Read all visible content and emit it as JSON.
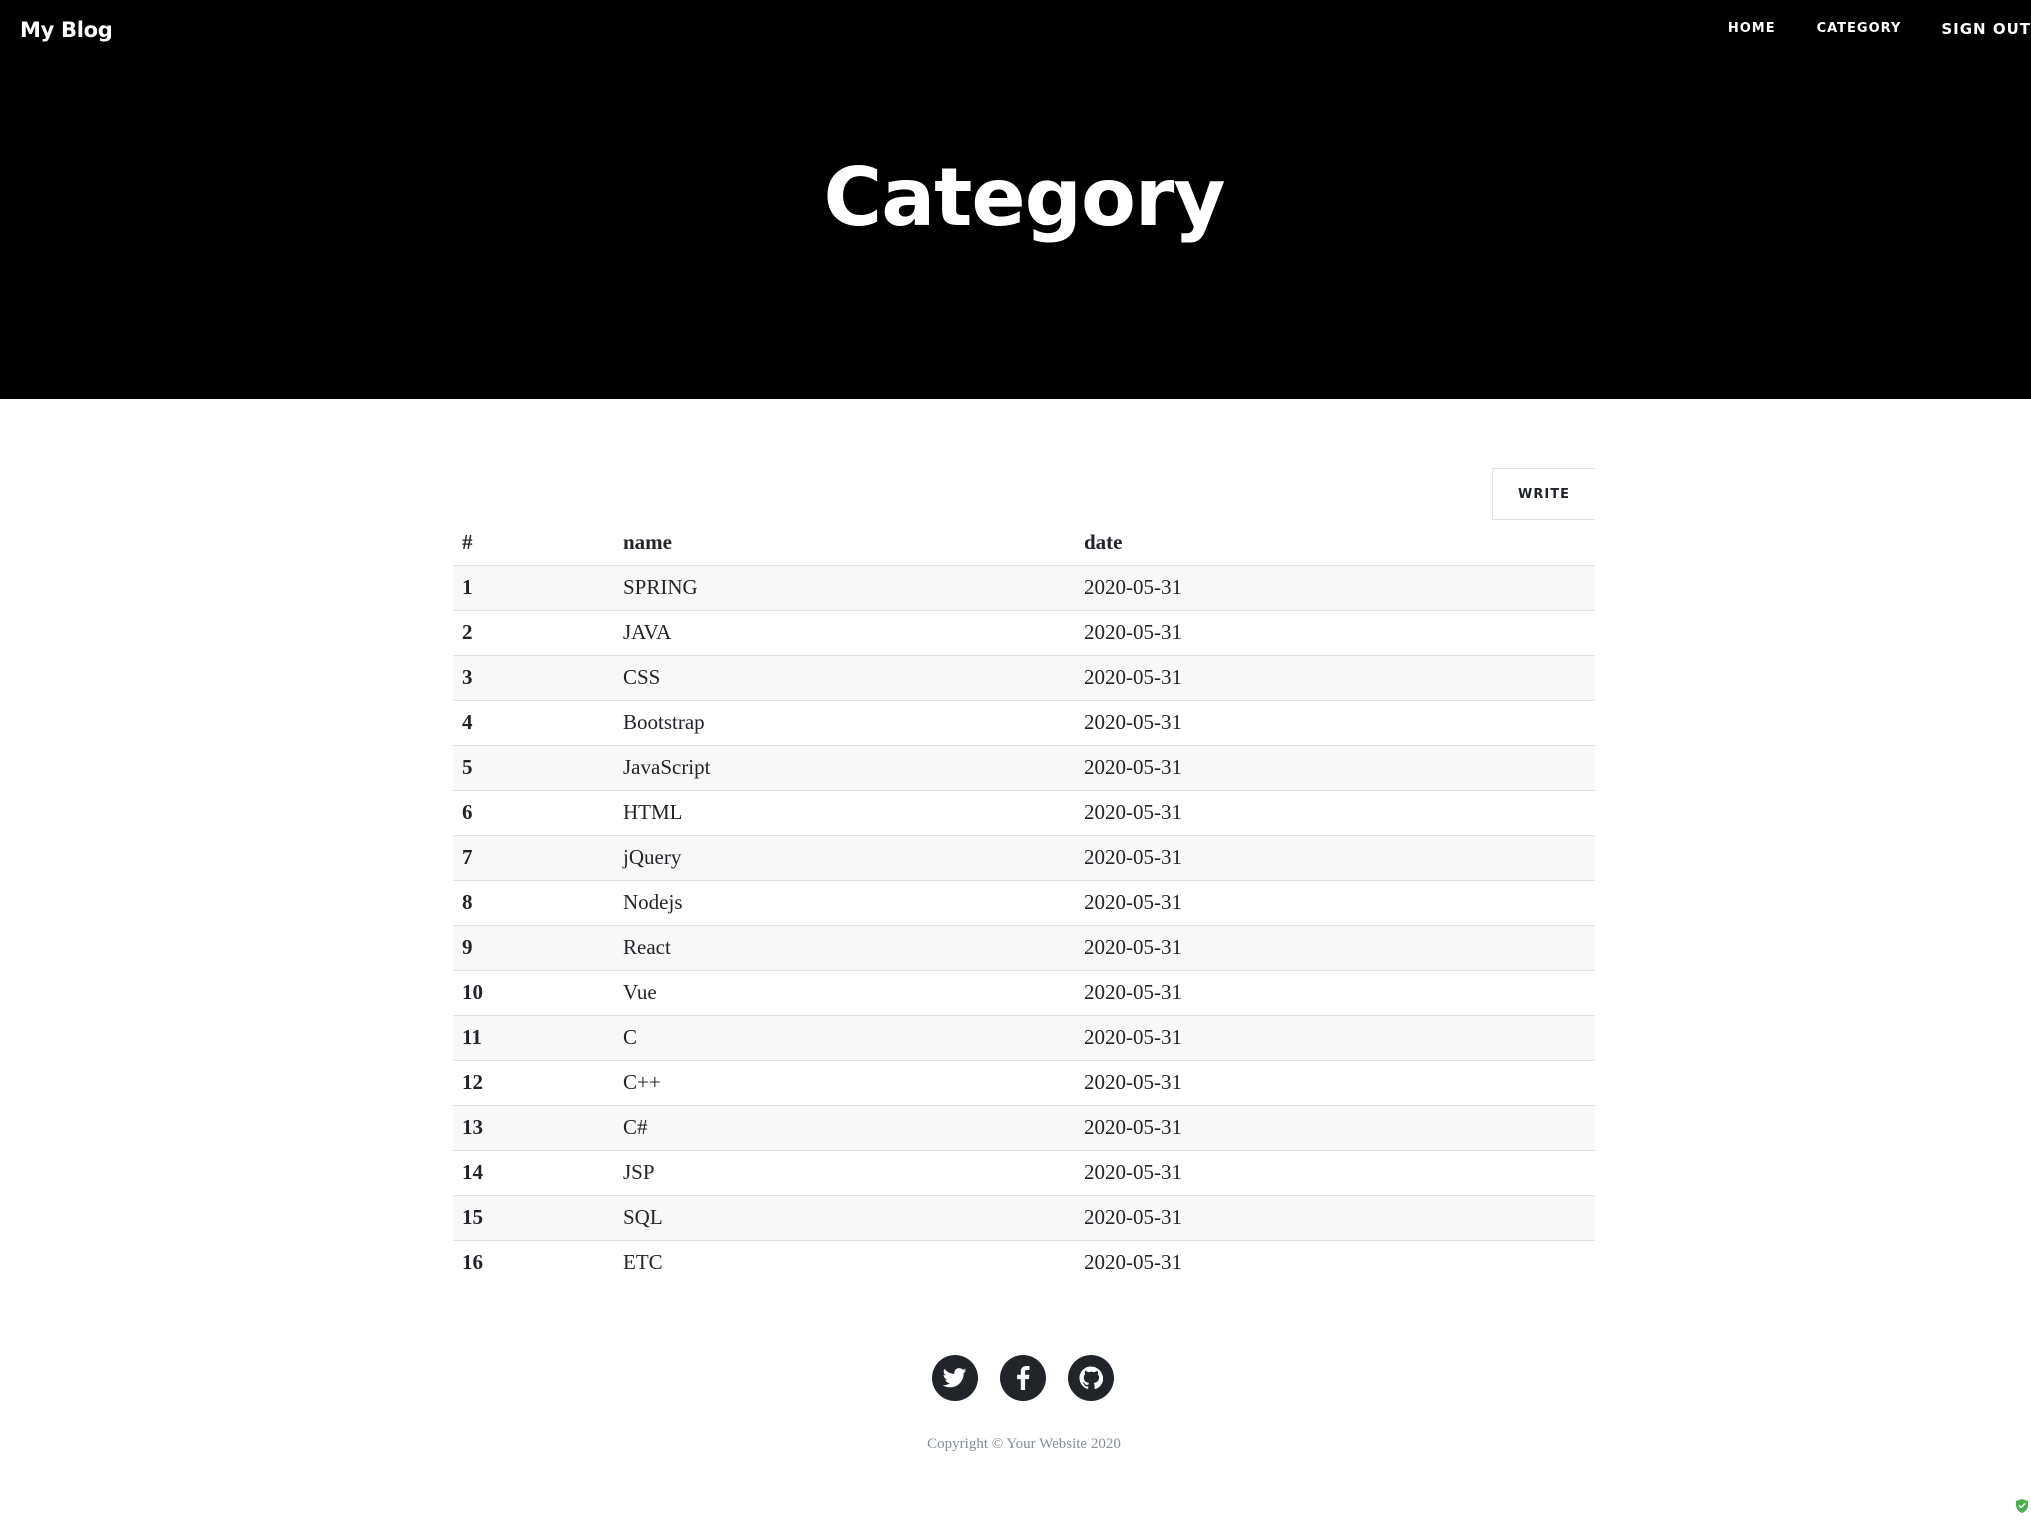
{
  "header": {
    "brand": "My Blog",
    "nav": [
      "HOME",
      "CATEGORY",
      "SIGN OUT"
    ],
    "title": "Category"
  },
  "toolbar": {
    "write_label": "WRITE"
  },
  "table": {
    "columns": [
      "#",
      "name",
      "date"
    ],
    "rows": [
      [
        "1",
        "SPRING",
        "2020-05-31"
      ],
      [
        "2",
        "JAVA",
        "2020-05-31"
      ],
      [
        "3",
        "CSS",
        "2020-05-31"
      ],
      [
        "4",
        "Bootstrap",
        "2020-05-31"
      ],
      [
        "5",
        "JavaScript",
        "2020-05-31"
      ],
      [
        "6",
        "HTML",
        "2020-05-31"
      ],
      [
        "7",
        "jQuery",
        "2020-05-31"
      ],
      [
        "8",
        "Nodejs",
        "2020-05-31"
      ],
      [
        "9",
        "React",
        "2020-05-31"
      ],
      [
        "10",
        "Vue",
        "2020-05-31"
      ],
      [
        "11",
        "C",
        "2020-05-31"
      ],
      [
        "12",
        "C++",
        "2020-05-31"
      ],
      [
        "13",
        "C#",
        "2020-05-31"
      ],
      [
        "14",
        "JSP",
        "2020-05-31"
      ],
      [
        "15",
        "SQL",
        "2020-05-31"
      ],
      [
        "16",
        "ETC",
        "2020-05-31"
      ]
    ]
  },
  "footer": {
    "social_icons": [
      "twitter-icon",
      "facebook-icon",
      "github-icon"
    ],
    "copyright": "Copyright © Your Website 2020"
  },
  "colors": {
    "header_bg": "#000000",
    "text": "#212529",
    "stripe": "#f8f8f8",
    "icon_bg": "#212529",
    "shield": "#4caf50"
  }
}
